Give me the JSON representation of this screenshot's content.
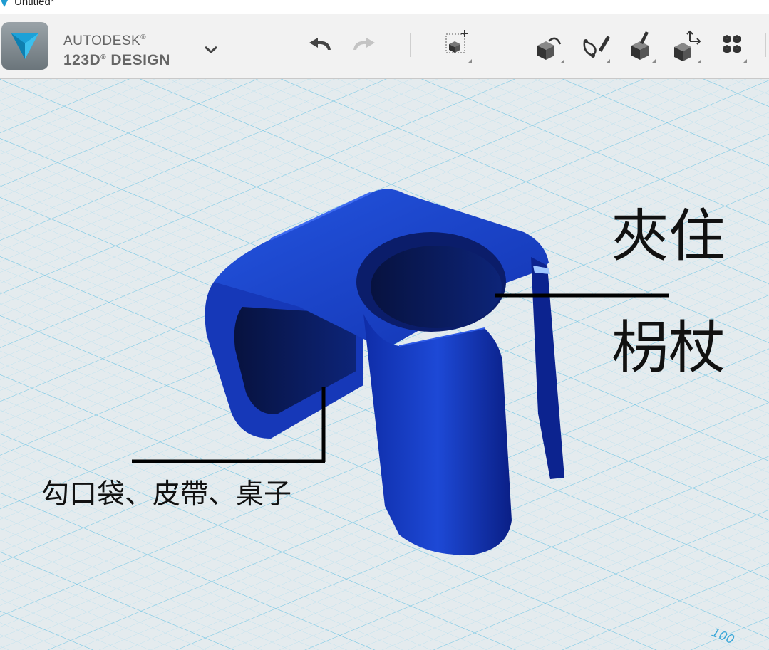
{
  "window": {
    "title": "Untitled*"
  },
  "brand": {
    "line1": "AUTODESK",
    "line2": "123D",
    "line3": "DESIGN",
    "reg": "®"
  },
  "toolbar": {
    "buttons": [
      {
        "name": "undo",
        "icon": "undo-icon"
      },
      {
        "name": "redo",
        "icon": "redo-icon"
      },
      {
        "name": "primitives",
        "icon": "primitives-box-icon"
      },
      {
        "name": "sketch",
        "icon": "sketch-icon"
      },
      {
        "name": "construct",
        "icon": "construct-icon"
      },
      {
        "name": "modify",
        "icon": "modify-icon"
      },
      {
        "name": "pattern",
        "icon": "pattern-icon"
      },
      {
        "name": "grouping",
        "icon": "grouping-icon"
      }
    ],
    "accent": "#1f9bd0"
  },
  "annotations": {
    "top_right_line1": "夾住",
    "top_right_line2": "枴杖",
    "bottom_left": "勾口袋、皮帶、桌子"
  },
  "viewport": {
    "grid_label": "100",
    "model_color": "#1a3fc4",
    "grid_color": "#8fd3ea",
    "background": "#e4ebee"
  }
}
